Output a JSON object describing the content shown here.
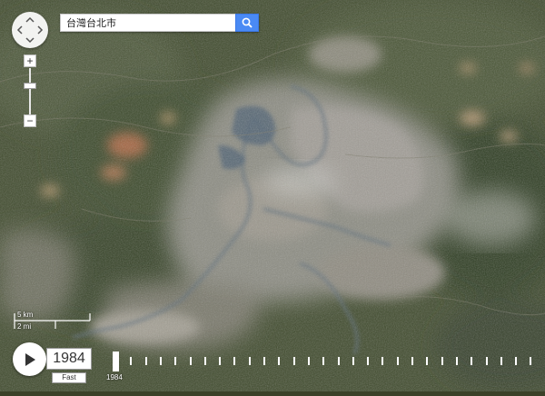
{
  "search": {
    "value": "台灣台北市"
  },
  "zoom": {
    "in_label": "+",
    "out_label": "−"
  },
  "scale": {
    "metric": "5 km",
    "imperial": "2 mi"
  },
  "timelapse": {
    "year": "1984",
    "speed": "Fast",
    "start_year_label": "1984",
    "tick_count": 29,
    "progress": 0
  },
  "colors": {
    "search_button": "#4a8af4",
    "panel": "#ffffff",
    "map_base": "#3b4128"
  },
  "icons": [
    "search-icon",
    "pan-arrows-icon",
    "play-icon"
  ]
}
